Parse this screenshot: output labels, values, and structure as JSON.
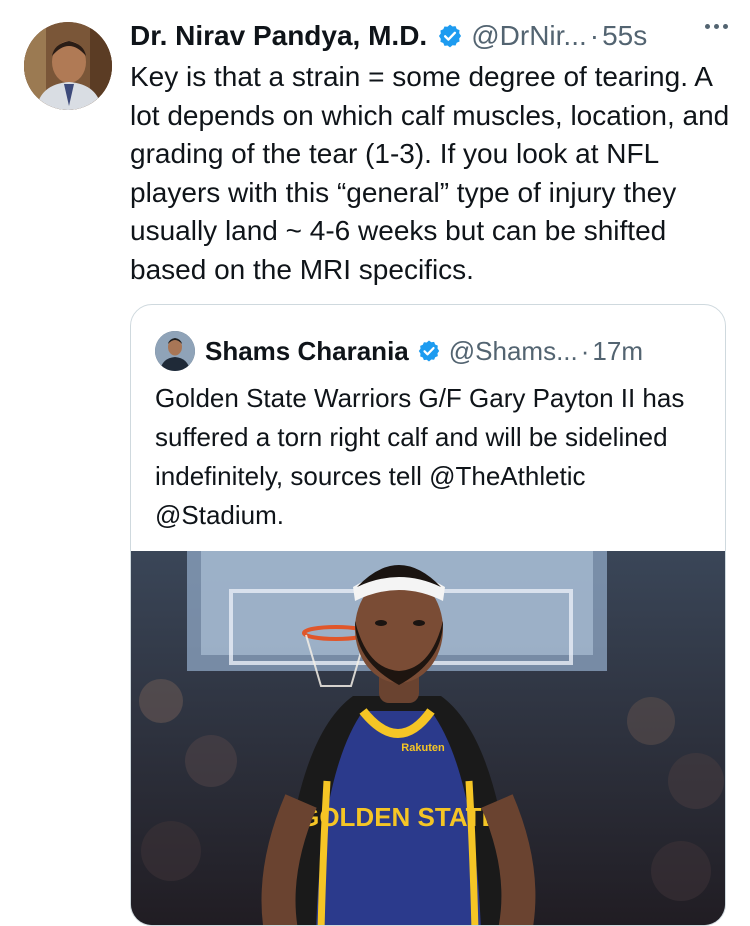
{
  "tweet": {
    "author_name": "Dr. Nirav Pandya, M.D.",
    "handle": "@DrNir...",
    "separator": "·",
    "time": "55s",
    "text": "Key is that a strain = some degree of tearing. A lot depends on which calf muscles, location, and grading of the tear (1-3). If you look at NFL players with this “general” type of injury they usually land ~ 4-6 weeks but can be shifted based on the MRI specifics."
  },
  "quoted_tweet": {
    "author_name": "Shams Charania",
    "handle": "@Shams...",
    "separator": "·",
    "time": "17m",
    "text": "Golden State Warriors G/F Gary Payton II has suffered a torn right calf and will be sidelined indefinitely, sources tell @TheAthletic @Stadium.",
    "media": {
      "jersey_text": "GOLDEN STATE",
      "sponsor_text": "Rakuten"
    }
  },
  "icons": {
    "verified": "verified-badge-icon",
    "more": "more-options-icon"
  },
  "colors": {
    "verified_blue": "#1d9bf0",
    "secondary_text": "#536471",
    "border": "#cfd9de",
    "jersey_navy": "#2b3a8c",
    "jersey_gold": "#f5c525"
  }
}
